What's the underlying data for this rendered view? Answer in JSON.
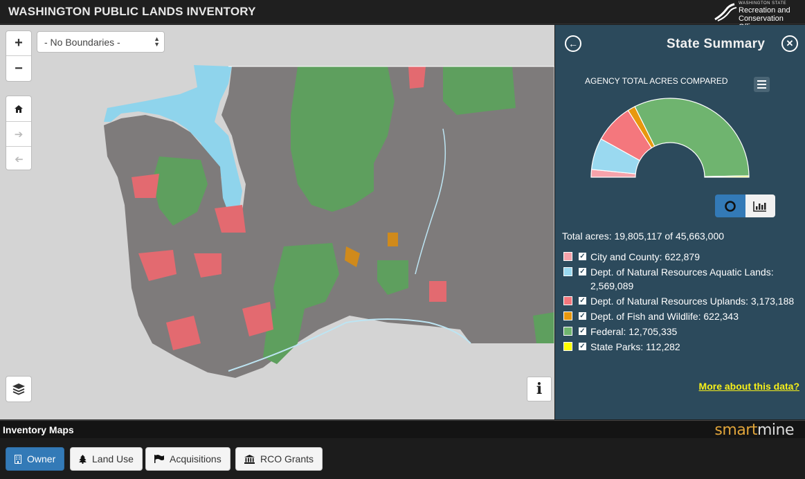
{
  "header": {
    "title": "WASHINGTON PUBLIC LANDS INVENTORY",
    "logo_small": "WASHINGTON STATE",
    "logo_line1": "Recreation and",
    "logo_line2": "Conservation Office"
  },
  "map_controls": {
    "zoom_in": "+",
    "zoom_out": "−",
    "boundary_select": "- No Boundaries -",
    "info": "i"
  },
  "panel": {
    "title": "State Summary",
    "chart_title": "AGENCY TOTAL ACRES COMPARED",
    "total": "Total acres: 19,805,117 of 45,663,000",
    "legend": [
      {
        "label": "City and County: 622,879",
        "color": "#f6a3ab"
      },
      {
        "label": "Dept. of Natural Resources Aquatic Lands: 2,569,089",
        "color": "#9ad9f0"
      },
      {
        "label": "Dept. of Natural Resources Uplands: 3,173,188",
        "color": "#f4777d"
      },
      {
        "label": "Dept. of Fish and Wildlife: 622,343",
        "color": "#e8980e"
      },
      {
        "label": "Federal: 12,705,335",
        "color": "#6fb46f"
      },
      {
        "label": "State Parks: 112,282",
        "color": "#ffff00"
      }
    ],
    "more_link": "More about this data?"
  },
  "chart_data": {
    "type": "pie",
    "title": "AGENCY TOTAL ACRES COMPARED",
    "categories": [
      "City and County",
      "Dept. of Natural Resources Aquatic Lands",
      "Dept. of Natural Resources Uplands",
      "Dept. of Fish and Wildlife",
      "Federal",
      "State Parks"
    ],
    "values": [
      622879,
      2569089,
      3173188,
      622343,
      12705335,
      112282
    ],
    "colors": [
      "#f6a3ab",
      "#9ad9f0",
      "#f4777d",
      "#e8980e",
      "#6fb46f",
      "#ffff00"
    ],
    "shape": "semi-donut"
  },
  "footer": {
    "section_title": "Inventory Maps",
    "brand_part1": "smart",
    "brand_part2": "mine",
    "tabs": [
      {
        "label": "Owner",
        "icon": "building-icon"
      },
      {
        "label": "Land Use",
        "icon": "tree-icon"
      },
      {
        "label": "Acquisitions",
        "icon": "flag-icon"
      },
      {
        "label": "RCO Grants",
        "icon": "bank-icon"
      }
    ]
  }
}
